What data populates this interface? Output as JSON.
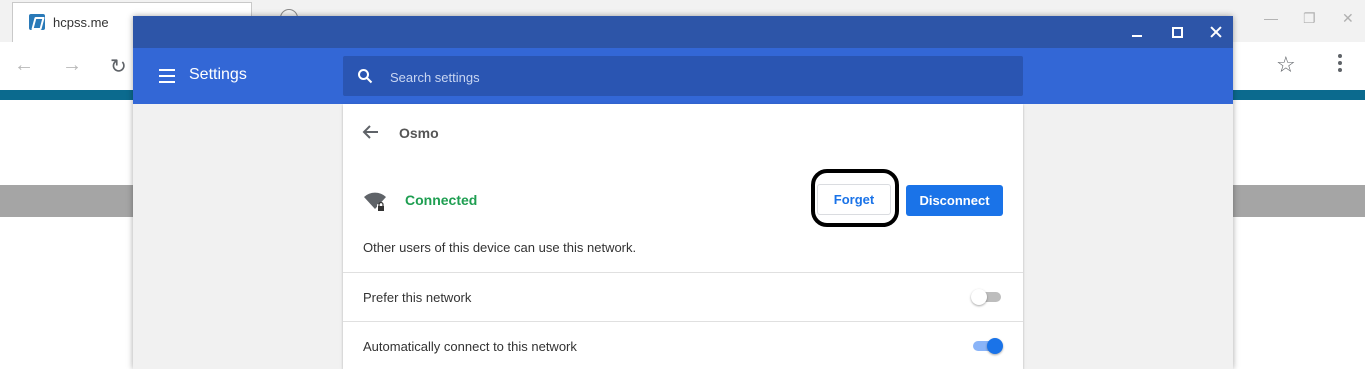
{
  "browser": {
    "tab_title": "hcpss.me"
  },
  "window": {
    "title_bar_color": "#2d55a8"
  },
  "settings": {
    "title": "Settings",
    "search": {
      "placeholder": "Search settings",
      "value": ""
    },
    "header_color": "#3367d6"
  },
  "network": {
    "name": "Osmo",
    "status": "Connected",
    "status_color": "#1e9e51",
    "forget_label": "Forget",
    "disconnect_label": "Disconnect",
    "shared_text": "Other users of this device can use this network.",
    "rows": [
      {
        "label": "Prefer this network",
        "enabled": false
      },
      {
        "label": "Automatically connect to this network",
        "enabled": true
      }
    ]
  },
  "accent_color": "#1a73e8"
}
